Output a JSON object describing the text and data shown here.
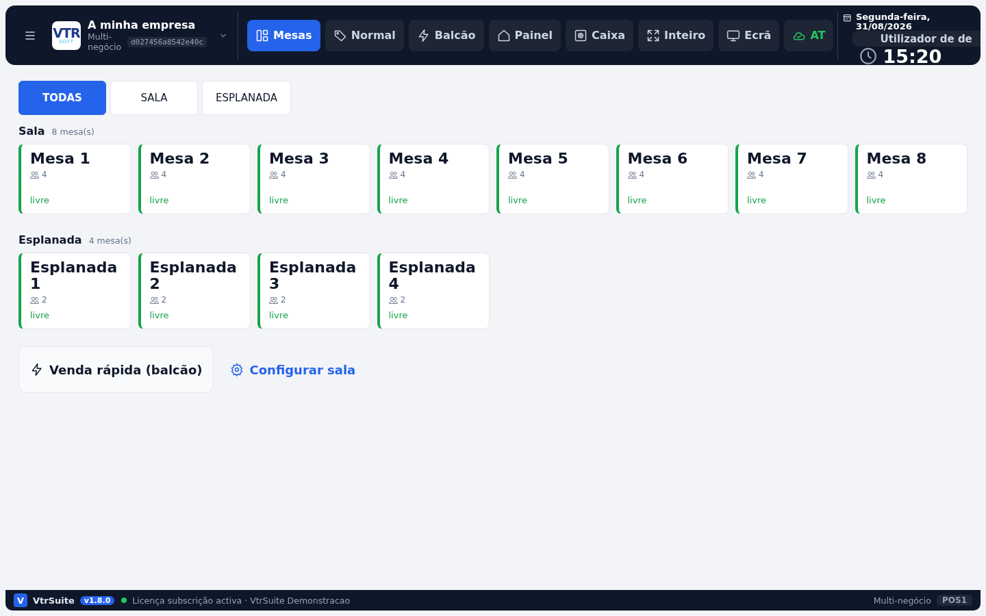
{
  "header": {
    "logo": {
      "mark": "VTR",
      "sub": "SOFT"
    },
    "company": "A minha empresa",
    "subtitle": "Multi-negócio",
    "company_id": "d027456a8542e40c",
    "nav": [
      {
        "label": "Mesas",
        "kind": "tables",
        "selected": true
      },
      {
        "label": "Normal",
        "kind": "tag",
        "selected": false
      },
      {
        "label": "Balcão",
        "kind": "bolt",
        "selected": false
      },
      {
        "label": "Painel",
        "kind": "home",
        "selected": false
      },
      {
        "label": "Caixa",
        "kind": "safe",
        "selected": false
      },
      {
        "label": "Inteiro",
        "kind": "expand",
        "selected": false
      },
      {
        "label": "Ecrã",
        "kind": "monitor",
        "selected": false
      },
      {
        "label": "AT",
        "kind": "cloud",
        "selected": false
      }
    ],
    "date": "Segunda-feira, 31/08/2026",
    "user": "Utilizador de de",
    "clock": "15:20"
  },
  "zone_tabs": [
    {
      "label": "TODAS",
      "selected": true
    },
    {
      "label": "SALA",
      "selected": false
    },
    {
      "label": "ESPLANADA",
      "selected": false
    }
  ],
  "sections": [
    {
      "name": "Sala",
      "count": "8 mesa(s)",
      "tables": [
        {
          "name": "Mesa 1",
          "seats": "4",
          "status": "livre"
        },
        {
          "name": "Mesa 2",
          "seats": "4",
          "status": "livre"
        },
        {
          "name": "Mesa 3",
          "seats": "4",
          "status": "livre"
        },
        {
          "name": "Mesa 4",
          "seats": "4",
          "status": "livre"
        },
        {
          "name": "Mesa 5",
          "seats": "4",
          "status": "livre"
        },
        {
          "name": "Mesa 6",
          "seats": "4",
          "status": "livre"
        },
        {
          "name": "Mesa 7",
          "seats": "4",
          "status": "livre"
        },
        {
          "name": "Mesa 8",
          "seats": "4",
          "status": "livre"
        }
      ]
    },
    {
      "name": "Esplanada",
      "count": "4 mesa(s)",
      "tables": [
        {
          "name": "Esplanada 1",
          "seats": "2",
          "status": "livre"
        },
        {
          "name": "Esplanada 2",
          "seats": "2",
          "status": "livre"
        },
        {
          "name": "Esplanada 3",
          "seats": "2",
          "status": "livre"
        },
        {
          "name": "Esplanada 4",
          "seats": "2",
          "status": "livre"
        }
      ]
    }
  ],
  "actions": {
    "quick_sale": "Venda rápida (balcão)",
    "configure": "Configurar sala"
  },
  "status_bar": {
    "badge": "V",
    "app": "VtrSuite",
    "version": "v1.8.0",
    "license_active": true,
    "license": "Licença subscrição activa · VtrSuite Demonstracao",
    "mode": "Multi-negócio",
    "terminal": "POS1"
  }
}
